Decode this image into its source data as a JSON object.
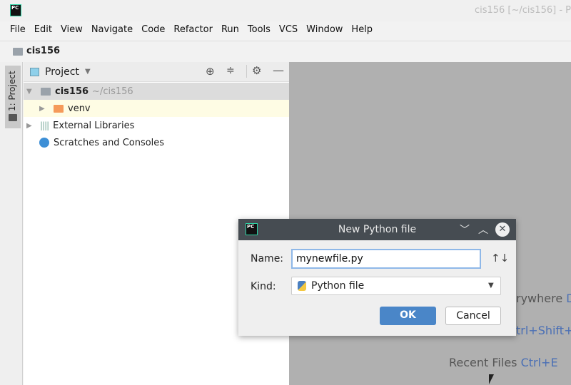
{
  "window": {
    "title": "cis156 [~/cis156] - P",
    "logo": "PC"
  },
  "menu": [
    "File",
    "Edit",
    "View",
    "Navigate",
    "Code",
    "Refactor",
    "Run",
    "Tools",
    "VCS",
    "Window",
    "Help"
  ],
  "breadcrumb": {
    "project": "cis156"
  },
  "sidebar_strip": {
    "tab": "1: Project"
  },
  "project_panel": {
    "title": "Project",
    "tree": [
      {
        "label": "cis156",
        "path": "~/cis156"
      },
      {
        "label": "venv"
      },
      {
        "label": "External Libraries"
      },
      {
        "label": "Scratches and Consoles"
      }
    ]
  },
  "editor_hints": [
    {
      "text": "rywhere ",
      "key": "D"
    },
    {
      "text": "",
      "key": "trl+Shift+"
    },
    {
      "text": "Recent Files ",
      "key": "Ctrl+E"
    }
  ],
  "dialog": {
    "logo": "PC",
    "title": "New Python file",
    "name_label": "Name:",
    "name_value": "mynewfile.py",
    "kind_label": "Kind:",
    "kind_value": "Python file",
    "ok": "OK",
    "cancel": "Cancel",
    "sort_icon": "↑↓"
  },
  "colors": {
    "accent": "#4a86c8",
    "editor_bg": "#b0b0b0",
    "venv_folder": "#f59a5a",
    "selected_row": "#fefce4"
  }
}
